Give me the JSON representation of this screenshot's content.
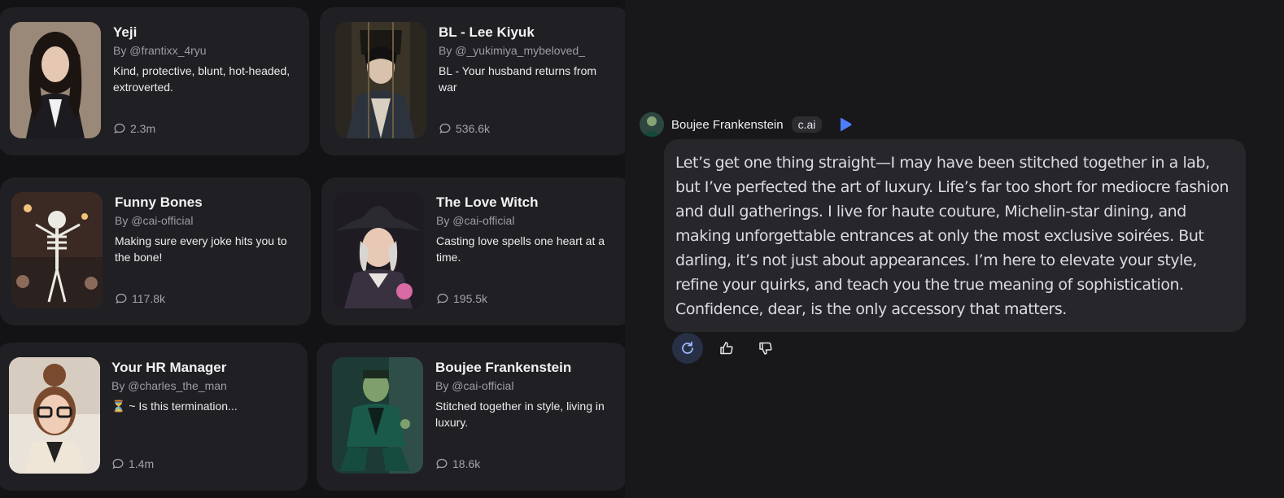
{
  "cards": [
    {
      "name": "Yeji",
      "by": "By @frantixx_4ryu",
      "desc": "Kind, protective, blunt, hot-headed, extroverted.",
      "chats": "2.3m"
    },
    {
      "name": "BL - Lee Kiyuk",
      "by": "By @_yukimiya_mybeloved_",
      "desc": "BL - Your husband returns from war",
      "chats": "536.6k"
    },
    {
      "name": "Funny Bones",
      "by": "By @cai-official",
      "desc": "Making sure every joke hits you to the bone!",
      "chats": "117.8k"
    },
    {
      "name": "The Love Witch",
      "by": "By @cai-official",
      "desc": "Casting love spells one heart at a time.",
      "chats": "195.5k"
    },
    {
      "name": "Your HR Manager",
      "by": "By @charles_the_man",
      "desc": "⏳ ~ Is this termination...",
      "chats": "1.4m"
    },
    {
      "name": "Boujee Frankenstein",
      "by": "By @cai-official",
      "desc": "Stitched together in style, living in luxury.",
      "chats": "18.6k"
    }
  ],
  "chat": {
    "character_name": "Boujee Frankenstein",
    "badge": "c.ai",
    "message": "Let’s get one thing straight—I may have been stitched together in a lab, but I’ve perfected the art of luxury. Life’s far too short for mediocre fashion and dull gatherings. I live for haute couture, Michelin-star dining, and making unforgettable entrances at only the most exclusive soirées. But darling, it’s not just about appearances. I’m here to elevate your style, refine your quirks, and teach you the true meaning of sophistication. Confidence, dear, is the only accessory that matters."
  },
  "colors": {
    "background": "#18181b",
    "card": "#202024",
    "bubble": "#26262b",
    "accent": "#4f7cff"
  },
  "icons": {
    "chat_count": "chat-bubble-icon",
    "play": "play-icon",
    "regenerate": "refresh-icon",
    "like": "thumbs-up-icon",
    "dislike": "thumbs-down-icon"
  }
}
